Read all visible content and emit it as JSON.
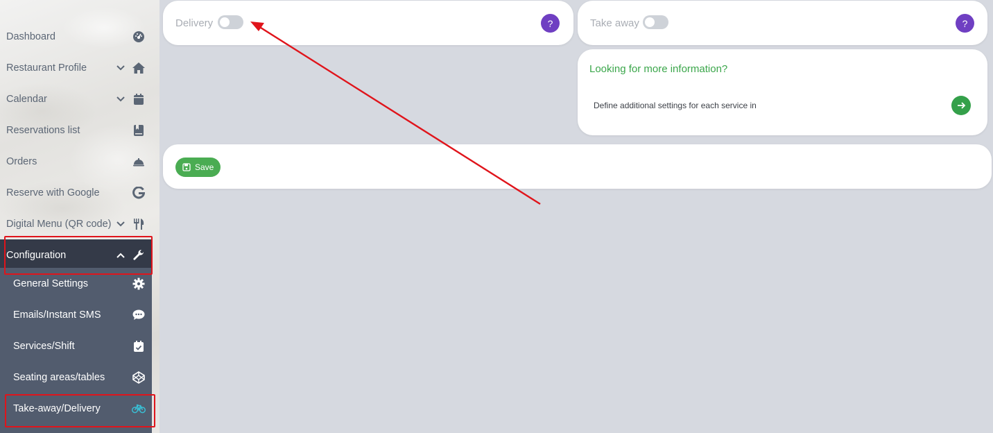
{
  "sidebar": {
    "items": [
      {
        "label": "Dashboard",
        "icon": "dashboard-icon"
      },
      {
        "label": "Restaurant Profile",
        "icon": "home-icon"
      },
      {
        "label": "Calendar",
        "icon": "calendar-icon"
      },
      {
        "label": "Reservations list",
        "icon": "book-icon"
      },
      {
        "label": "Orders",
        "icon": "bell-icon"
      },
      {
        "label": "Reserve with Google",
        "icon": "google-icon"
      },
      {
        "label": "Digital Menu (QR code)",
        "icon": "utensils-icon"
      },
      {
        "label": "Configuration",
        "icon": "wrench-icon"
      }
    ],
    "subitems": [
      {
        "label": "General Settings",
        "icon": "gear-icon"
      },
      {
        "label": "Emails/Instant SMS",
        "icon": "chat-icon"
      },
      {
        "label": "Services/Shift",
        "icon": "calendar-check-icon"
      },
      {
        "label": "Seating areas/tables",
        "icon": "codepen-icon"
      },
      {
        "label": "Take-away/Delivery",
        "icon": "bicycle-icon"
      }
    ]
  },
  "delivery": {
    "label": "Delivery",
    "enabled": false,
    "help": "?"
  },
  "takeaway": {
    "label": "Take away",
    "enabled": false,
    "help": "?"
  },
  "info": {
    "title": "Looking for more information?",
    "text": "Define additional settings for each service in"
  },
  "save": {
    "label": "Save"
  },
  "colors": {
    "accent_purple": "#6f3fc2",
    "accent_green": "#3aa64a",
    "active_nav": "#343a48",
    "submenu": "#525c6e",
    "highlight_red": "#e0141b"
  }
}
